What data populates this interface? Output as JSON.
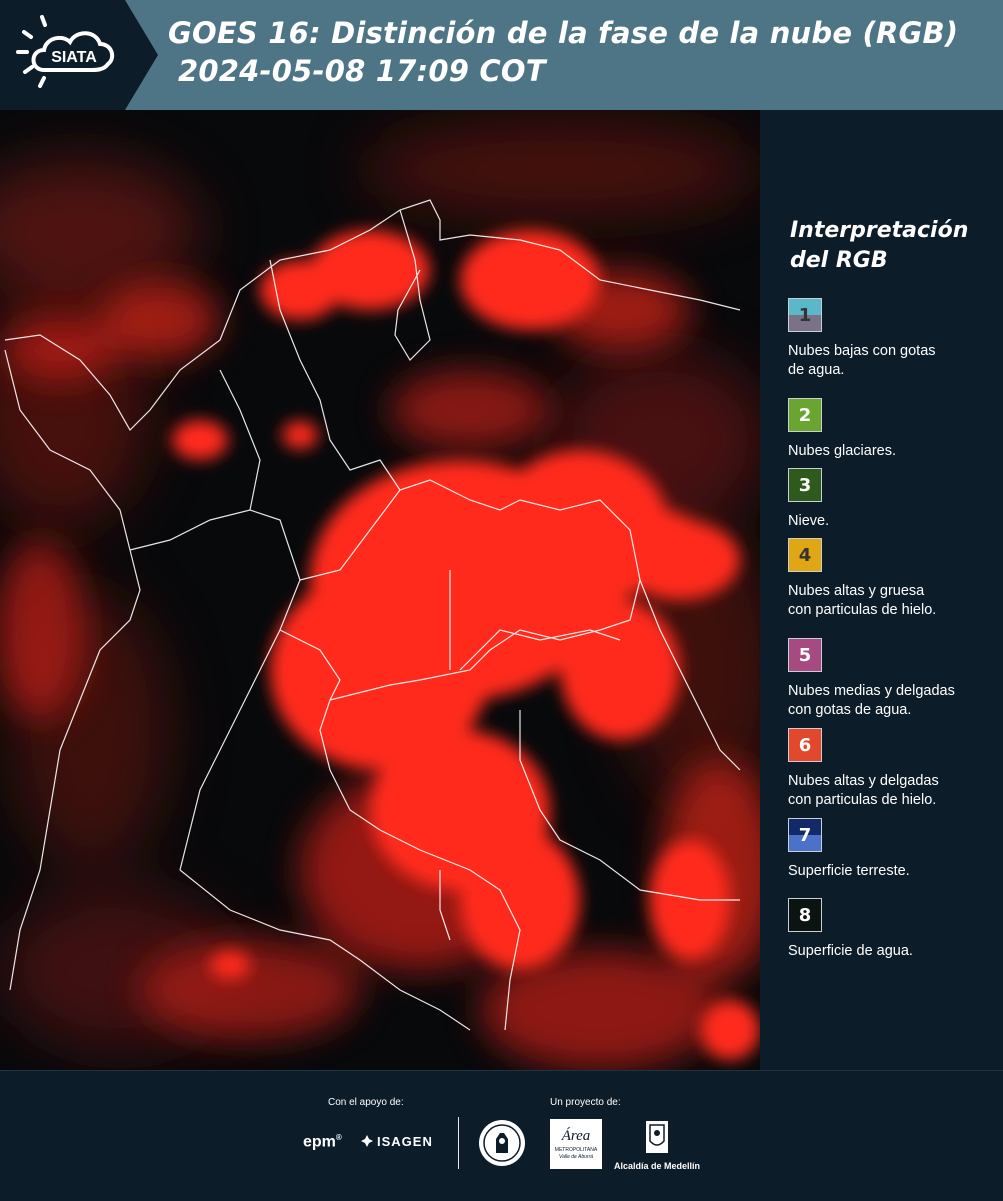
{
  "header": {
    "title_line1": "GOES 16: Distinción de la fase de la nube (RGB)",
    "title_line2": "2024-05-08 17:09 COT",
    "logo_text": "SIATA"
  },
  "legend": {
    "title_line1": "Interpretación",
    "title_line2": "del RGB",
    "items": [
      {
        "num": "1",
        "label_lines": [
          "Nubes bajas con gotas",
          "de agua."
        ],
        "color_top": "#5ab8c8",
        "color_bottom": "#7a7288",
        "text_color": "#333333"
      },
      {
        "num": "2",
        "label_lines": [
          "Nubes glaciares."
        ],
        "color_top": "#6aa530",
        "color_bottom": "#6aa530",
        "text_color": "#ffffff"
      },
      {
        "num": "3",
        "label_lines": [
          "Nieve."
        ],
        "color_top": "#2f5a1e",
        "color_bottom": "#2f5a1e",
        "text_color": "#ffffff"
      },
      {
        "num": "4",
        "label_lines": [
          "Nubes altas y gruesa",
          "con particulas de hielo."
        ],
        "color_top": "#e0a614",
        "color_bottom": "#e0a614",
        "text_color": "#333333"
      },
      {
        "num": "5",
        "label_lines": [
          "Nubes medias y delgadas",
          "con gotas de agua."
        ],
        "color_top": "#a84a82",
        "color_bottom": "#a84a82",
        "text_color": "#ffffff"
      },
      {
        "num": "6",
        "label_lines": [
          "Nubes altas y delgadas",
          "con particulas de hielo."
        ],
        "color_top": "#e2492c",
        "color_bottom": "#e2492c",
        "text_color": "#ffffff"
      },
      {
        "num": "7",
        "label_lines": [
          "Superficie terreste."
        ],
        "color_top": "#132a68",
        "color_bottom": "#4b72c8",
        "text_color": "#ffffff"
      },
      {
        "num": "8",
        "label_lines": [
          "Superficie de agua."
        ],
        "color_top": "#0b1410",
        "color_bottom": "#0b1410",
        "text_color": "#ffffff"
      }
    ]
  },
  "footer": {
    "support_label": "Con el apoyo de:",
    "project_label": "Un proyecto de:",
    "epm": "epm",
    "isagen": "ISAGEN",
    "area_name": "Área",
    "area_sub1": "METROPOLITANA",
    "area_sub2": "Valle de Aburrá",
    "alcaldia": "Alcaldía de Medellín"
  },
  "colors": {
    "header_bg": "#4e7586",
    "panel_bg": "#0c1c28",
    "cloud_red": "#ff2a1a"
  }
}
